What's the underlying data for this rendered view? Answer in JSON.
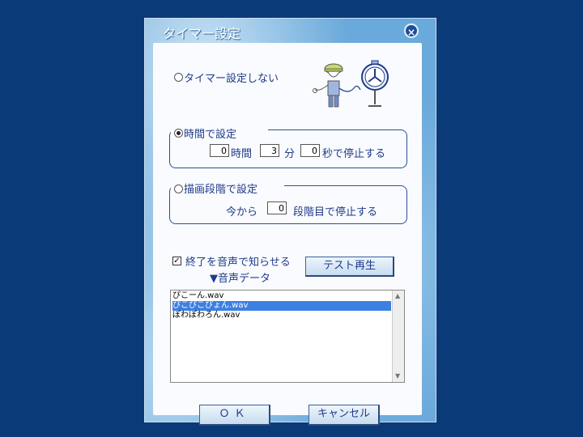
{
  "dialog": {
    "title": "タイマー設定",
    "close_glyph": "×"
  },
  "options": {
    "no_timer_label": "タイマー設定しない",
    "time_label": "時間で設定",
    "stage_label": "描画段階で設定",
    "selected": "time"
  },
  "time": {
    "hours_value": "0",
    "hours_unit": "時間",
    "minutes_value": "3",
    "minutes_unit": "分",
    "seconds_value": "0",
    "seconds_unit": "秒で停止する"
  },
  "stage": {
    "prefix": "今から",
    "value": "0",
    "suffix": "段階目で停止する"
  },
  "sound": {
    "notify_label": "終了を音声で知らせる",
    "notify_checked": true,
    "test_button": "テスト再生",
    "data_label": "▼音声データ",
    "files": [
      "ぴこーん.wav",
      "ぴこぴこぴょん.wav",
      "ぽわぽわろん.wav"
    ],
    "selected_index": 1
  },
  "buttons": {
    "ok": "ＯＫ",
    "cancel": "キャンセル"
  },
  "icons": {
    "close": "close-icon",
    "illustration": "character-with-alarm-clock-illustration",
    "scroll_up": "scroll-up-arrow-icon",
    "scroll_down": "scroll-down-arrow-icon"
  }
}
